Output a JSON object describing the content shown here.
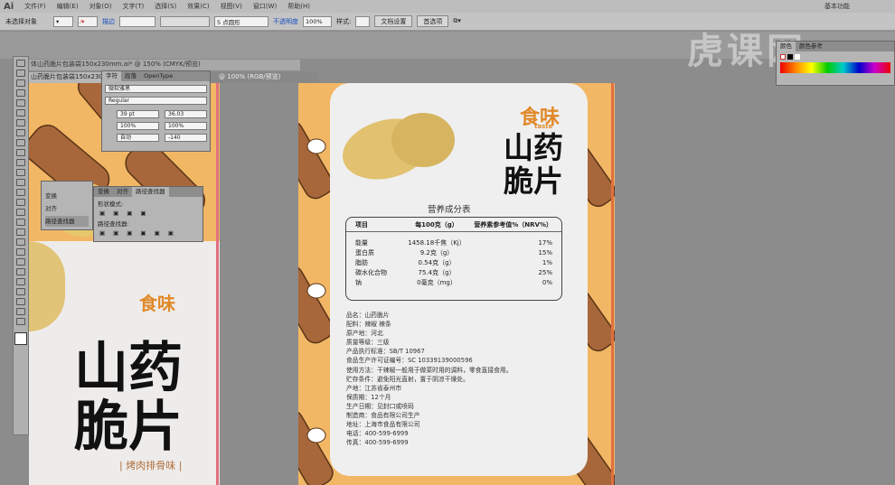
{
  "app": {
    "logo": "Ai",
    "menus": [
      "文件(F)",
      "编辑(E)",
      "对象(O)",
      "文字(T)",
      "选择(S)",
      "效果(C)",
      "视图(V)",
      "窗口(W)",
      "帮助(H)"
    ],
    "workspace": "基本功能"
  },
  "control": {
    "selection": "未选择对象",
    "stroke_label": "描边",
    "brush": "5 点圆形",
    "opacity_label": "不透明度",
    "opacity": "100%",
    "style_label": "样式:",
    "doc_setup": "文档设置",
    "prefs": "首选项"
  },
  "docs": {
    "tab1": "体山药脆片包装袋150x230mm.ai* @ 150% (CMYK/预览)",
    "tab1b": "山药脆片包装袋150x230mm",
    "tab2": "@ 100% (RGB/预览)"
  },
  "char_panel": {
    "tabs": [
      "字符",
      "段落",
      "OpenType"
    ],
    "font": "微软雅黑",
    "style": "Regular",
    "size": "39 pt",
    "leading": "36.03",
    "hscale": "100%",
    "vscale": "100%",
    "kern": "自动",
    "track": "-140"
  },
  "small_panel": {
    "items": [
      "变换",
      "对齐",
      "路径查找器"
    ]
  },
  "pathfinder": {
    "tabs": [
      "变换",
      "对齐",
      "路径查找器"
    ],
    "shape_modes": "形状模式:",
    "pathfinders": "路径查找器:"
  },
  "color_panel": {
    "tabs": [
      "颜色",
      "颜色参考"
    ]
  },
  "watermark": "虎课网",
  "package": {
    "brand": "食味",
    "brand_sub": "taste",
    "title1": "山药",
    "title2": "脆片",
    "flavor": "| 烤肉排骨味 |",
    "nutrition_title": "营养成分表",
    "headers": [
      "项目",
      "每100克（g）",
      "营养素参考值%（NRV%）"
    ],
    "rows": [
      [
        "能量",
        "1458.18千焦（Kj）",
        "17%"
      ],
      [
        "蛋白质",
        "9.2克（g）",
        "15%"
      ],
      [
        "脂肪",
        "0.54克（g）",
        "1%"
      ],
      [
        "碳水化合物",
        "75.4克（g）",
        "25%"
      ],
      [
        "钠",
        "0毫克（mg）",
        "0%"
      ]
    ],
    "info": [
      "品名：山药脆片",
      "配料：辣椒 辣条",
      "原产地：河北",
      "质量等级：三级",
      "产品执行标准：SB/T 10967",
      "食品生产许可证编号：SC 10339139000596",
      "使用方法：干辣椒一般用于做菜时用的调料，零食直接食用。",
      "贮存条件：避免阳光直射，置于阴凉干燥处。",
      "产地：江苏省泰州市",
      "保质期：12个月",
      "生产日期：见封口或喷码",
      "制造商：食品有限公司生产",
      "地址：上海市食品有限公司",
      "电话：400-599-6999",
      "传真：400-599-6999"
    ]
  }
}
